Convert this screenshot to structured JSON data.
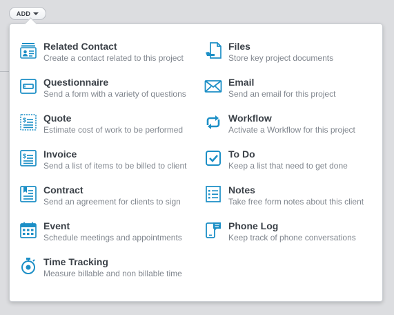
{
  "add_button": {
    "label": "ADD"
  },
  "accent_color": "#1c8fc6",
  "menu": {
    "left": [
      {
        "title": "Related Contact",
        "desc": "Create a contact related to this project",
        "icon": "related-contact-icon"
      },
      {
        "title": "Questionnaire",
        "desc": "Send a form with a variety of questions",
        "icon": "questionnaire-icon"
      },
      {
        "title": "Quote",
        "desc": "Estimate cost of work to be performed",
        "icon": "quote-icon"
      },
      {
        "title": "Invoice",
        "desc": "Send a list of items to be billed to client",
        "icon": "invoice-icon"
      },
      {
        "title": "Contract",
        "desc": "Send an agreement for clients to sign",
        "icon": "contract-icon"
      },
      {
        "title": "Event",
        "desc": "Schedule meetings and appointments",
        "icon": "calendar-icon"
      },
      {
        "title": "Time Tracking",
        "desc": "Measure billable and non billable time",
        "icon": "stopwatch-icon"
      }
    ],
    "right": [
      {
        "title": "Files",
        "desc": "Store key project documents",
        "icon": "file-icon"
      },
      {
        "title": "Email",
        "desc": "Send an email for this project",
        "icon": "envelope-icon"
      },
      {
        "title": "Workflow",
        "desc": "Activate a Workflow for this project",
        "icon": "workflow-icon"
      },
      {
        "title": "To Do",
        "desc": "Keep a list that need to get done",
        "icon": "checkbox-icon"
      },
      {
        "title": "Notes",
        "desc": "Take free form notes about this client",
        "icon": "notes-icon"
      },
      {
        "title": "Phone Log",
        "desc": "Keep track of phone conversations",
        "icon": "phone-icon"
      }
    ]
  }
}
